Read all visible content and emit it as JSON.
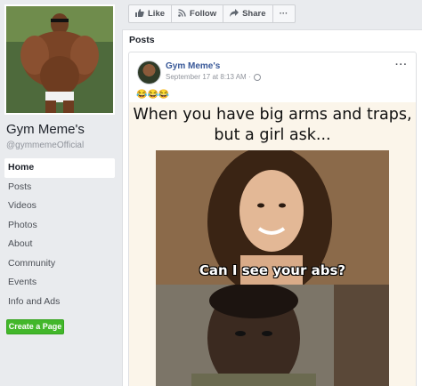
{
  "page": {
    "name": "Gym Meme's",
    "handle": "@gymmemeOfficial"
  },
  "nav": {
    "items": [
      {
        "label": "Home",
        "active": true
      },
      {
        "label": "Posts",
        "active": false
      },
      {
        "label": "Videos",
        "active": false
      },
      {
        "label": "Photos",
        "active": false
      },
      {
        "label": "About",
        "active": false
      },
      {
        "label": "Community",
        "active": false
      },
      {
        "label": "Events",
        "active": false
      },
      {
        "label": "Info and Ads",
        "active": false
      }
    ],
    "create_page_label": "Create a Page"
  },
  "toolbar": {
    "like_label": "Like",
    "follow_label": "Follow",
    "share_label": "Share",
    "more_label": "···"
  },
  "posts": {
    "section_title": "Posts",
    "post": {
      "author": "Gym Meme's",
      "timestamp": "September 17 at 8:13 AM ·",
      "emojis": "😂😂😂",
      "more_label": "···",
      "meme_caption_line1": "When you have big arms and traps,",
      "meme_caption_line2": "but a girl ask...",
      "meme_subtitle": "Can I see your abs?"
    }
  },
  "colors": {
    "brand_link": "#385898",
    "create_button": "#42b72a",
    "background": "#e9ebee"
  }
}
